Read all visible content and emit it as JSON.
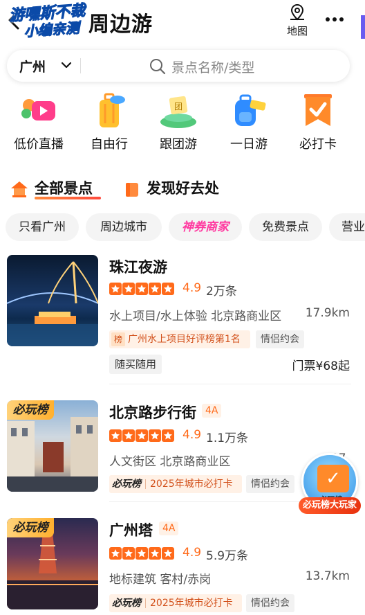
{
  "header": {
    "title": "周边游",
    "watermark_line1": "游嘿斯不裁",
    "watermark_line2": "小编亲测",
    "map_label": "地图"
  },
  "search": {
    "city": "广州",
    "placeholder": "景点名称/类型"
  },
  "categories": [
    {
      "label": "低价直播",
      "icon": "live-stream-icon"
    },
    {
      "label": "自由行",
      "icon": "luggage-icon"
    },
    {
      "label": "跟团游",
      "icon": "tour-group-icon"
    },
    {
      "label": "一日游",
      "icon": "backpack-icon"
    },
    {
      "label": "必打卡",
      "icon": "checkmark-flag-icon"
    }
  ],
  "section_tabs": {
    "all": "全部景点",
    "discover": "发现好去处"
  },
  "filters": [
    "只看广州",
    "周边城市",
    "神券商家",
    "免费景点",
    "营业"
  ],
  "items": [
    {
      "name": "珠江夜游",
      "score": "4.9",
      "reviews": "2万条",
      "meta": "水上项目/水上体验  北京路商业区",
      "distance": "17.9km",
      "rank_icon": "榜",
      "rank_text": "广州水上项目好评榜第1名",
      "tag": "情侣约会",
      "chip": "随买随用",
      "price": "门票¥68起"
    },
    {
      "name": "北京路步行街",
      "level": "4A",
      "badge": "必玩榜",
      "score": "4.9",
      "reviews": "1.1万条",
      "meta": "人文街区  北京路商业区",
      "distance": "17.",
      "vip_logo": "必玩榜",
      "vip_text": "2025年城市必打卡",
      "tag": "情侣约会"
    },
    {
      "name": "广州塔",
      "level": "4A",
      "badge": "必玩榜",
      "score": "4.9",
      "reviews": "5.9万条",
      "meta": "地标建筑  客村/赤岗",
      "distance": "13.7km",
      "vip_logo": "必玩榜",
      "vip_text": "2025年城市必打卡",
      "tag": "情侣约会"
    }
  ],
  "float_badge": {
    "top": "必玩榜",
    "label": "必玩榜大玩家"
  },
  "colors": {
    "accent": "#ff6a1a",
    "brand_pink": "#ff3aa0"
  }
}
